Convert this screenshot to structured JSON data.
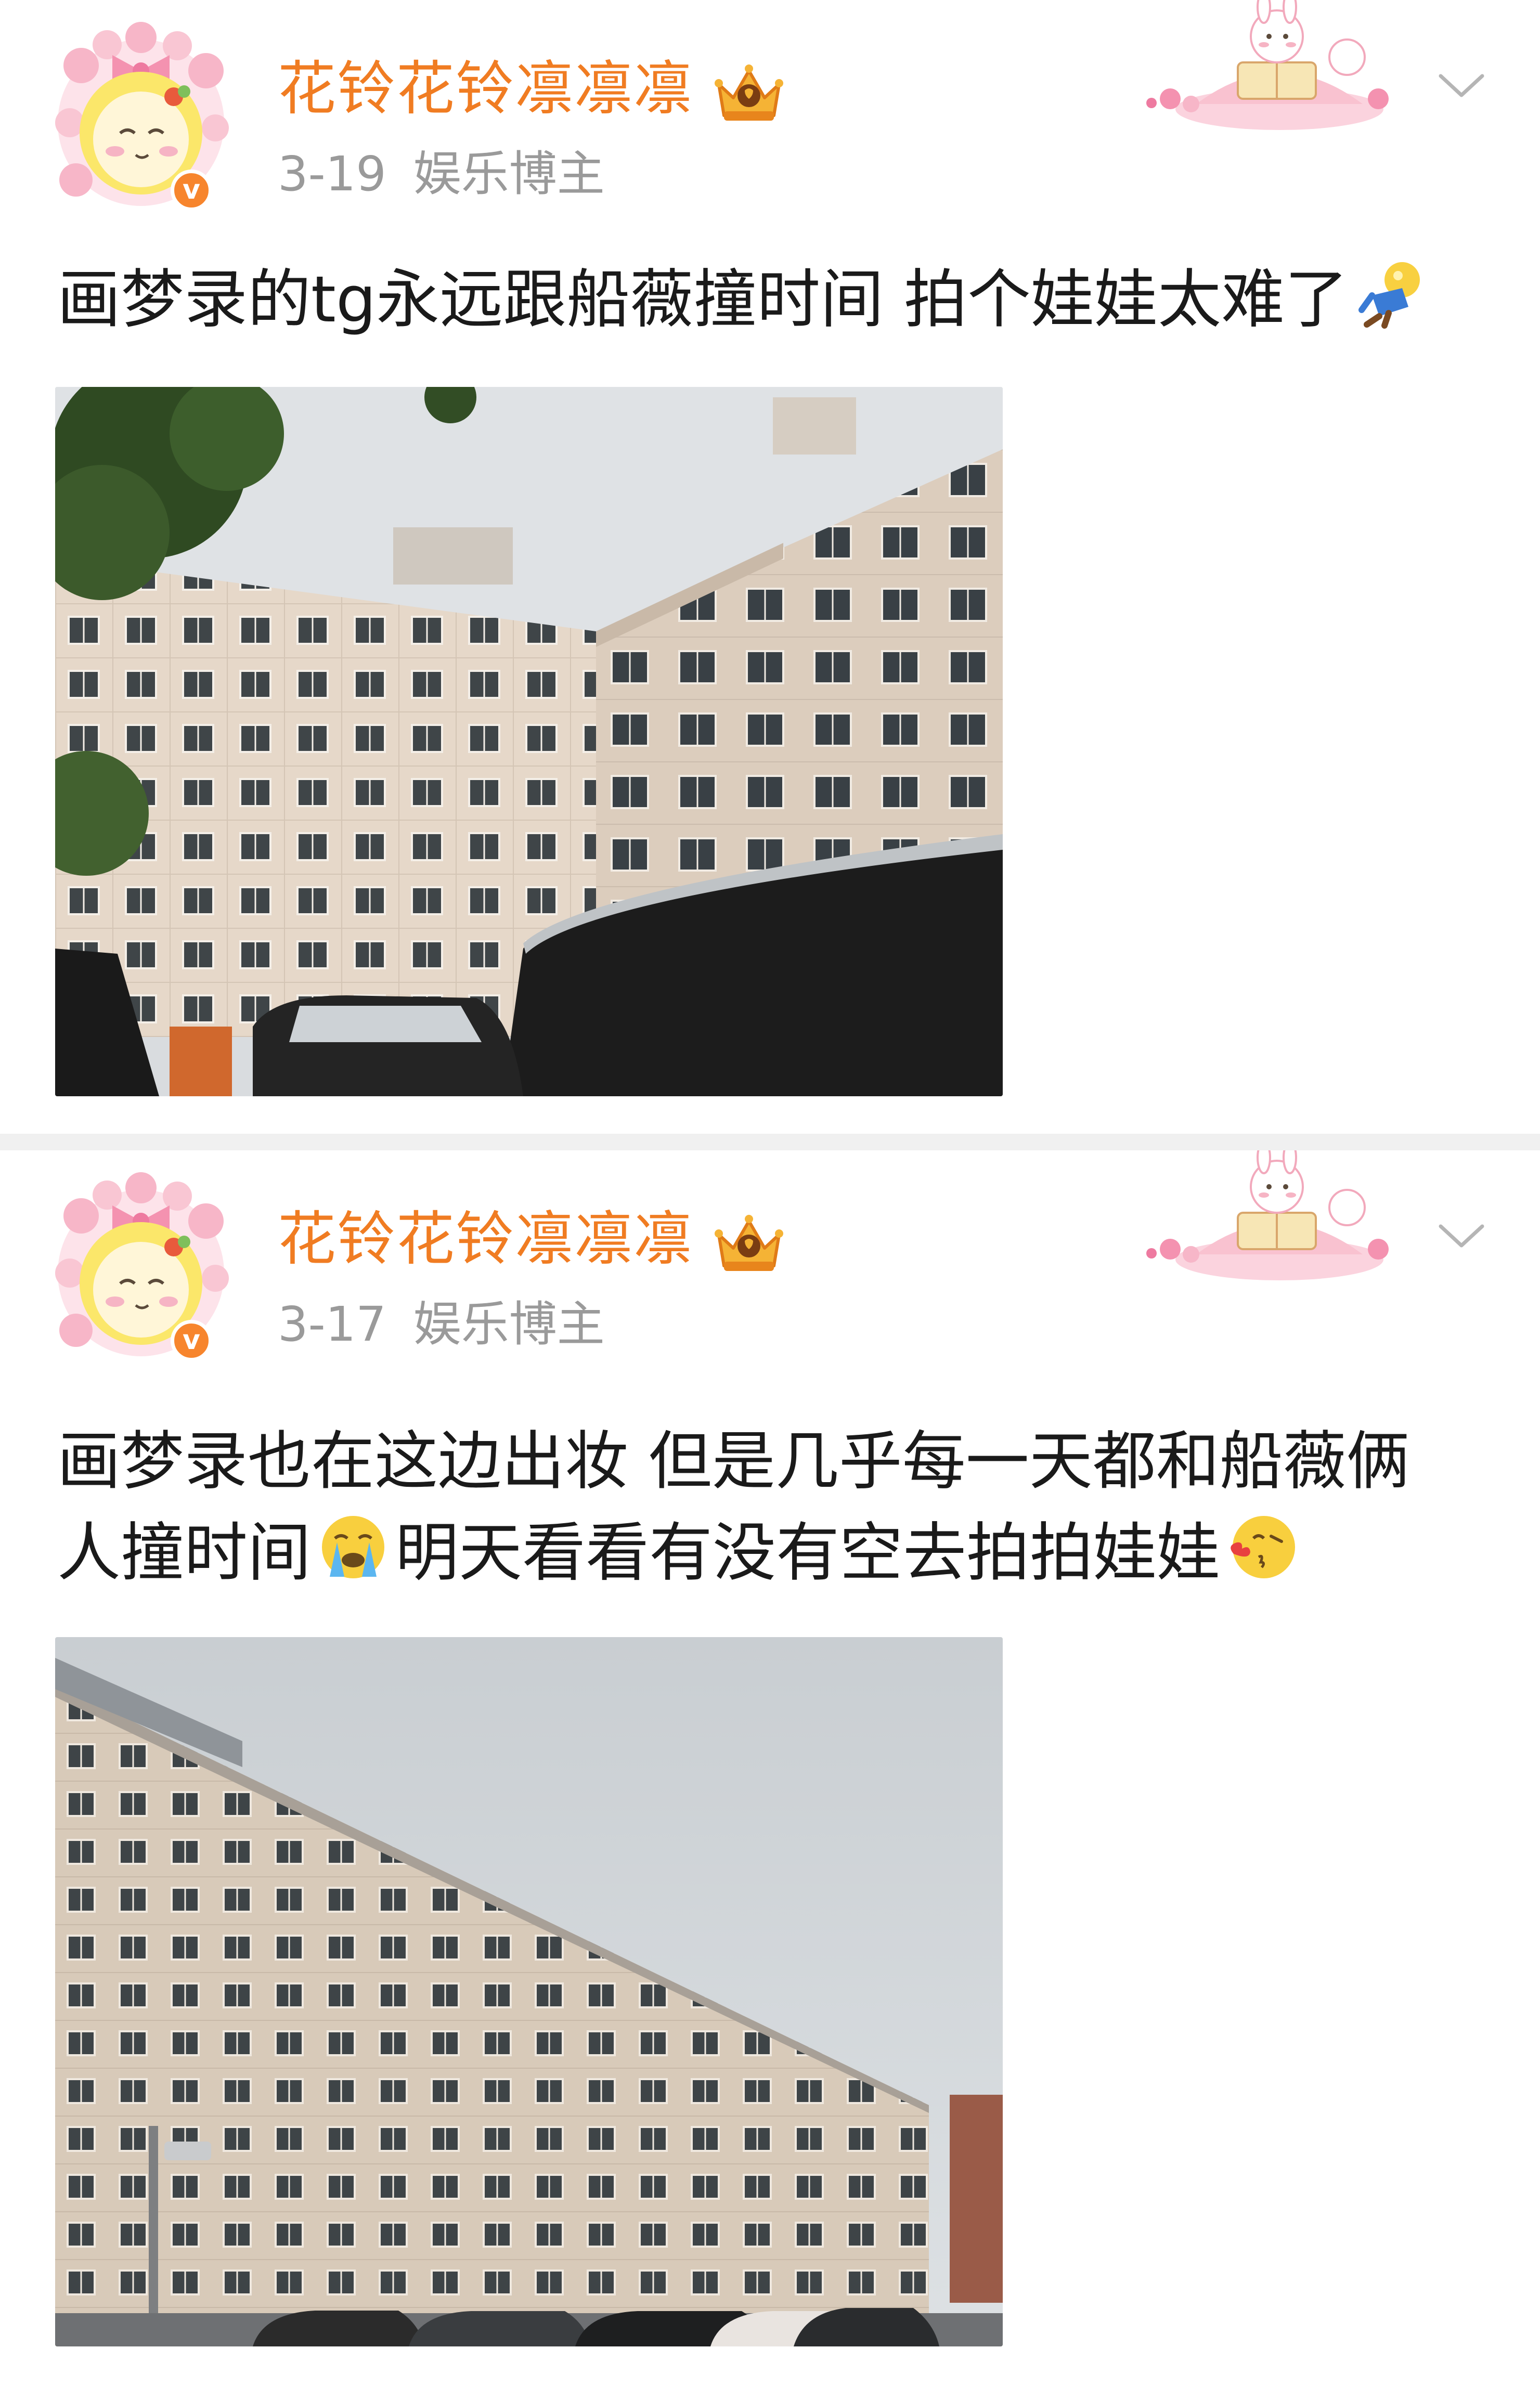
{
  "posts": [
    {
      "author": "花铃花铃凛凛凛",
      "date": "3-19",
      "source": "娱乐博主",
      "text_lines": [
        "画梦录的tg永远跟船薇撞时间 拍个娃娃太难了"
      ],
      "emojis": [
        "doll-emoji"
      ],
      "image_alt": "building-photo"
    },
    {
      "author": "花铃花铃凛凛凛",
      "date": "3-17",
      "source": "娱乐博主",
      "text_line1": "画梦录也在这边出妆 但是几乎每一天都和船薇俩",
      "text_line2_part1": "人撞时间",
      "text_line2_part2": "明天看看有没有空去拍拍娃娃",
      "emojis": [
        "crying-emoji",
        "kiss-emoji"
      ],
      "image_alt": "building-photo"
    }
  ],
  "icons": {
    "verified_badge": "v",
    "crown_icon": "crown",
    "more_icon": "chevron-down"
  },
  "colors": {
    "author_name": "#f07c22",
    "meta_text": "#9a9a9a",
    "divider": "#f0f0f0",
    "verified_badge": "#f7852d"
  }
}
